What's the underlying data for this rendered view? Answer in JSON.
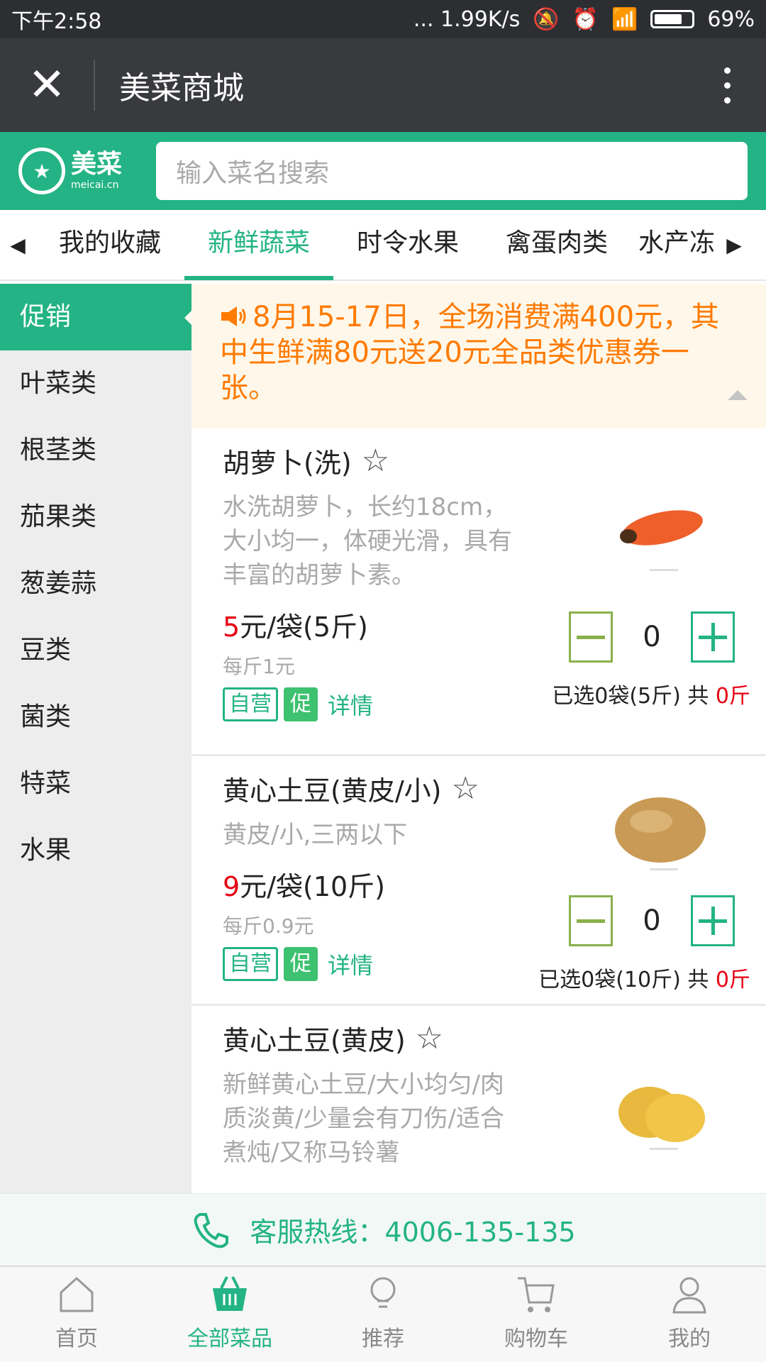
{
  "status_bar": {
    "time": "下午2:58",
    "network": "... 1.99K/s",
    "battery": "69%",
    "battery_level": 0.69
  },
  "title_bar": {
    "title": "美菜商城"
  },
  "header": {
    "logo_cn": "美菜",
    "logo_en": "meicai.cn",
    "search_placeholder": "输入菜名搜索"
  },
  "category_tabs": [
    {
      "label": "我的收藏"
    },
    {
      "label": "新鲜蔬菜",
      "active": true
    },
    {
      "label": "时令水果"
    },
    {
      "label": "禽蛋肉类"
    },
    {
      "label": "水产冻"
    }
  ],
  "sidebar": [
    {
      "label": "促销",
      "active": true
    },
    {
      "label": "叶菜类"
    },
    {
      "label": "根茎类"
    },
    {
      "label": "茄果类"
    },
    {
      "label": "葱姜蒜"
    },
    {
      "label": "豆类"
    },
    {
      "label": "菌类"
    },
    {
      "label": "特菜"
    },
    {
      "label": "水果"
    }
  ],
  "notice": {
    "text": "8月15-17日，全场消费满400元，其中生鲜满80元送20元全品类优惠券一张。"
  },
  "products": [
    {
      "name": "胡萝卜(洗)",
      "desc": "水洗胡萝卜，长约18cm，大小均一，体硬光滑，具有丰富的胡萝卜素。",
      "price_num": "5",
      "price_unit": "元/袋(5斤)",
      "unit_price": "每斤1元",
      "tag_self": "自营",
      "tag_promo": "促",
      "detail": "详情",
      "qty": "0",
      "selected_text": "已选0袋(5斤) 共 ",
      "selected_total": "0斤"
    },
    {
      "name": "黄心土豆(黄皮/小)",
      "desc": "黄皮/小,三两以下",
      "price_num": "9",
      "price_unit": "元/袋(10斤)",
      "unit_price": "每斤0.9元",
      "tag_self": "自营",
      "tag_promo": "促",
      "detail": "详情",
      "qty": "0",
      "selected_text": "已选0袋(10斤) 共 ",
      "selected_total": "0斤"
    },
    {
      "name": "黄心土豆(黄皮)",
      "desc": "新鲜黄心土豆/大小均匀/肉质淡黄/少量会有刀伤/适合煮炖/又称马铃薯"
    }
  ],
  "hotline": {
    "text": "客服热线：4006-135-135"
  },
  "tabbar": [
    {
      "label": "首页",
      "icon": "home-icon"
    },
    {
      "label": "全部菜品",
      "icon": "basket-icon",
      "active": true
    },
    {
      "label": "推荐",
      "icon": "bulb-icon"
    },
    {
      "label": "购物车",
      "icon": "cart-icon"
    },
    {
      "label": "我的",
      "icon": "user-icon"
    }
  ],
  "colors": {
    "brand": "#23b384",
    "price_red": "#e60012",
    "notice_orange": "#ff7a00"
  }
}
